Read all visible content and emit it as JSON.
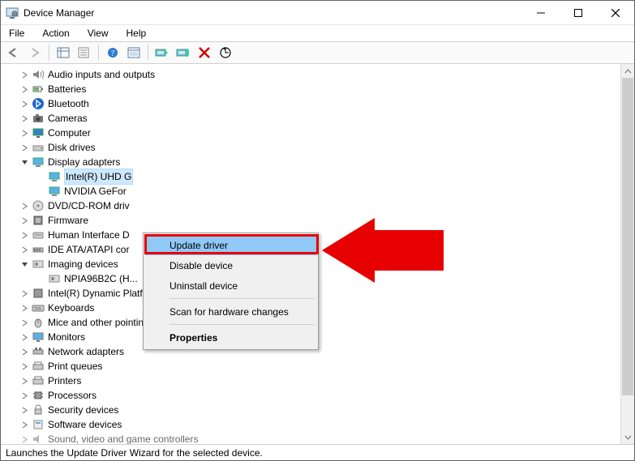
{
  "window": {
    "title": "Device Manager"
  },
  "menubar": {
    "file": "File",
    "action": "Action",
    "view": "View",
    "help": "Help"
  },
  "tree": {
    "root": "",
    "cat": {
      "audio": "Audio inputs and outputs",
      "batteries": "Batteries",
      "bluetooth": "Bluetooth",
      "cameras": "Cameras",
      "computer": "Computer",
      "disk": "Disk drives",
      "display": "Display adapters",
      "dvd": "DVD/CD-ROM driv",
      "firmware": "Firmware",
      "hid": "Human Interface D",
      "ide": "IDE ATA/ATAPI cor",
      "imaging": "Imaging devices",
      "platform": "Intel(R) Dynamic Platform and Thermal Framework",
      "keyboards": "Keyboards",
      "mice": "Mice and other pointing devices",
      "monitors": "Monitors",
      "network": "Network adapters",
      "printq": "Print queues",
      "printers": "Printers",
      "processors": "Processors",
      "security": "Security devices",
      "software": "Software devices",
      "sound": "Sound, video and game controllers"
    },
    "display_children": {
      "intel": "Intel(R) UHD G",
      "nvidia": "NVIDIA GeFor"
    },
    "imaging_children": {
      "npia": "NPIA96B2C (H..."
    }
  },
  "context_menu": {
    "update": "Update driver",
    "disable": "Disable device",
    "uninstall": "Uninstall device",
    "scan": "Scan for hardware changes",
    "properties": "Properties"
  },
  "status": "Launches the Update Driver Wizard for the selected device."
}
